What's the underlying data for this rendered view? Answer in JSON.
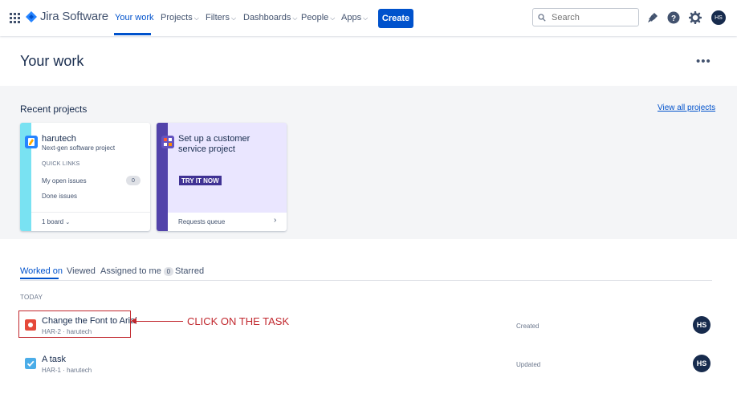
{
  "nav": {
    "product": "Jira Software",
    "items": [
      {
        "label": "Your work",
        "dropdown": false,
        "active": true
      },
      {
        "label": "Projects",
        "dropdown": true
      },
      {
        "label": "Filters",
        "dropdown": true
      },
      {
        "label": "Dashboards",
        "dropdown": true
      },
      {
        "label": "People",
        "dropdown": true
      },
      {
        "label": "Apps",
        "dropdown": true
      }
    ],
    "create_label": "Create",
    "search_placeholder": "Search",
    "user_initials": "HS",
    "icons": [
      "apps-grid-icon",
      "notifications-icon",
      "help-icon",
      "settings-icon"
    ]
  },
  "page": {
    "title": "Your work",
    "more_label": "•••"
  },
  "recent": {
    "title": "Recent projects",
    "view_all": "View all projects",
    "project_card": {
      "name": "harutech",
      "type": "Next-gen software project",
      "quick_links_label": "QUICK LINKS",
      "links": [
        {
          "label": "My open issues",
          "count": "0"
        },
        {
          "label": "Done issues"
        }
      ],
      "board_label": "1 board",
      "accent_color": "#79e2f2"
    },
    "promo_card": {
      "title": "Set up a customer service project",
      "cta": "TRY IT NOW",
      "footer_link": "Requests queue",
      "accent_color": "#5243aa"
    }
  },
  "tabs": [
    {
      "label": "Worked on",
      "active": true
    },
    {
      "label": "Viewed"
    },
    {
      "label": "Assigned to me",
      "count": "0"
    },
    {
      "label": "Starred"
    }
  ],
  "section_label": "TODAY",
  "tasks": [
    {
      "title": "Change the Font to Arial",
      "key": "HAR-2",
      "project": "harutech",
      "status": "Created",
      "assignee": "HS",
      "icon_color": "#e5493a",
      "icon": "bug-icon"
    },
    {
      "title": "A task",
      "key": "HAR-1",
      "project": "harutech",
      "status": "Updated",
      "assignee": "HS",
      "icon_color": "#4bade8",
      "icon": "task-check-icon"
    }
  ],
  "annotation": {
    "callout": "CLICK ON THE TASK",
    "color": "#c1272d"
  }
}
